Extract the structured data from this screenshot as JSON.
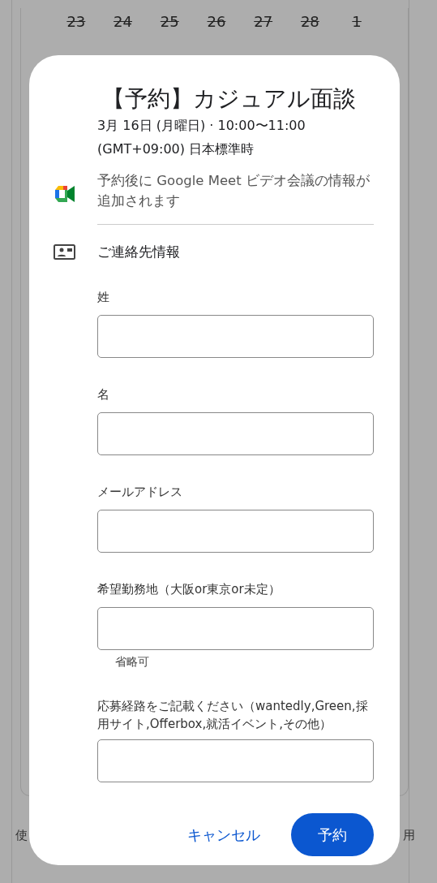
{
  "calendar_days": [
    {
      "label": "23",
      "disabled": true
    },
    {
      "label": "24",
      "disabled": true
    },
    {
      "label": "25",
      "disabled": true
    },
    {
      "label": "26",
      "disabled": true
    },
    {
      "label": "27",
      "disabled": true
    },
    {
      "label": "28",
      "disabled": true
    },
    {
      "label": "1",
      "disabled": true
    }
  ],
  "background_text": {
    "left": "使",
    "right": "用"
  },
  "dialog": {
    "title": "【予約】カジュアル面談",
    "date": "3月 16日 (月曜日) · 10:00〜11:00",
    "timezone": "(GMT+09:00) 日本標準時",
    "meet_note": "予約後に Google Meet ビデオ会議の情報が追加されます",
    "contact_heading": "ご連絡先情報",
    "fields": [
      {
        "label": "姓"
      },
      {
        "label": "名"
      },
      {
        "label": "メールアドレス"
      },
      {
        "label": "希望勤務地（大阪or東京or未定）",
        "hint": "省略可"
      },
      {
        "label": "応募経路をご記載ください（wantedly,Green,採用サイト,Offerbox,就活イベント,その他）"
      }
    ],
    "buttons": [
      {
        "label": "キャンセル",
        "kind": "text"
      },
      {
        "label": "予約",
        "kind": "filled"
      }
    ]
  }
}
